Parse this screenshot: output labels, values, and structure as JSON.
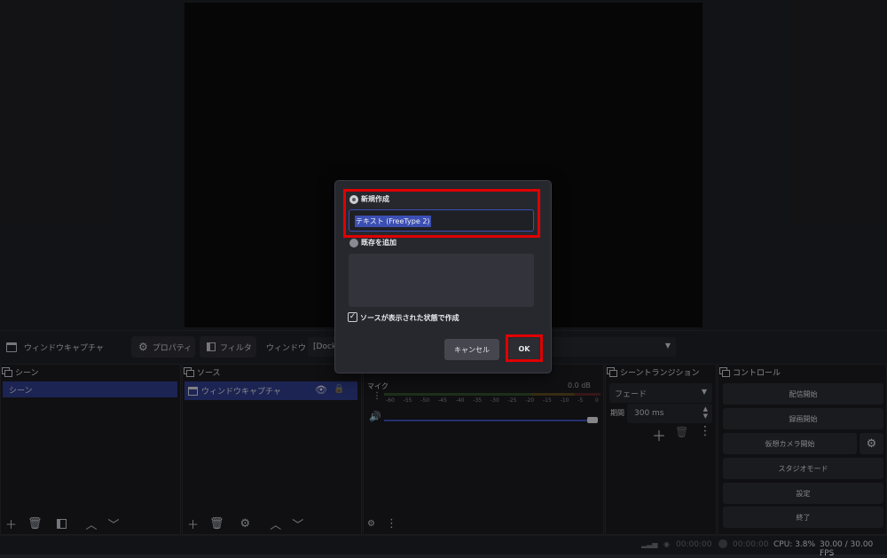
{
  "toolbar": {
    "source_name": "ウィンドウキャプチャ",
    "properties_label": "プロパティ",
    "filters_label": "フィルタ",
    "window_label": "ウィンドウ",
    "window_value": "[Dock]"
  },
  "scenes": {
    "title": "シーン",
    "items": [
      "シーン"
    ]
  },
  "sources": {
    "title": "ソース",
    "items": [
      "ウィンドウキャプチャ"
    ]
  },
  "mixer": {
    "channel": "マイク",
    "level": "0.0 dB",
    "ticks": [
      "-60",
      "-55",
      "-50",
      "-45",
      "-40",
      "-35",
      "-30",
      "-25",
      "-20",
      "-15",
      "-10",
      "-5",
      "0"
    ]
  },
  "transitions": {
    "title": "シーントランジション",
    "type": "フェード",
    "duration_label": "期間",
    "duration_value": "300 ms"
  },
  "controls": {
    "title": "コントロール",
    "start_streaming": "配信開始",
    "start_recording": "録画開始",
    "virtual_camera": "仮想カメラ開始",
    "studio_mode": "スタジオモード",
    "settings": "設定",
    "exit": "終了"
  },
  "status": {
    "stream_time": "00:00:00",
    "rec_time": "00:00:00",
    "cpu": "CPU: 3.8%",
    "fps": "30.00 / 30.00 FPS"
  },
  "dialog": {
    "create_new_label": "新規作成",
    "name_value": "テキスト (FreeType 2)",
    "add_existing_label": "既存を追加",
    "visible_checkbox_label": "ソースが表示された状態で作成",
    "cancel_label": "キャンセル",
    "ok_label": "OK"
  },
  "colors": {
    "accent": "#3b4fb3",
    "highlight": "#e00000"
  }
}
